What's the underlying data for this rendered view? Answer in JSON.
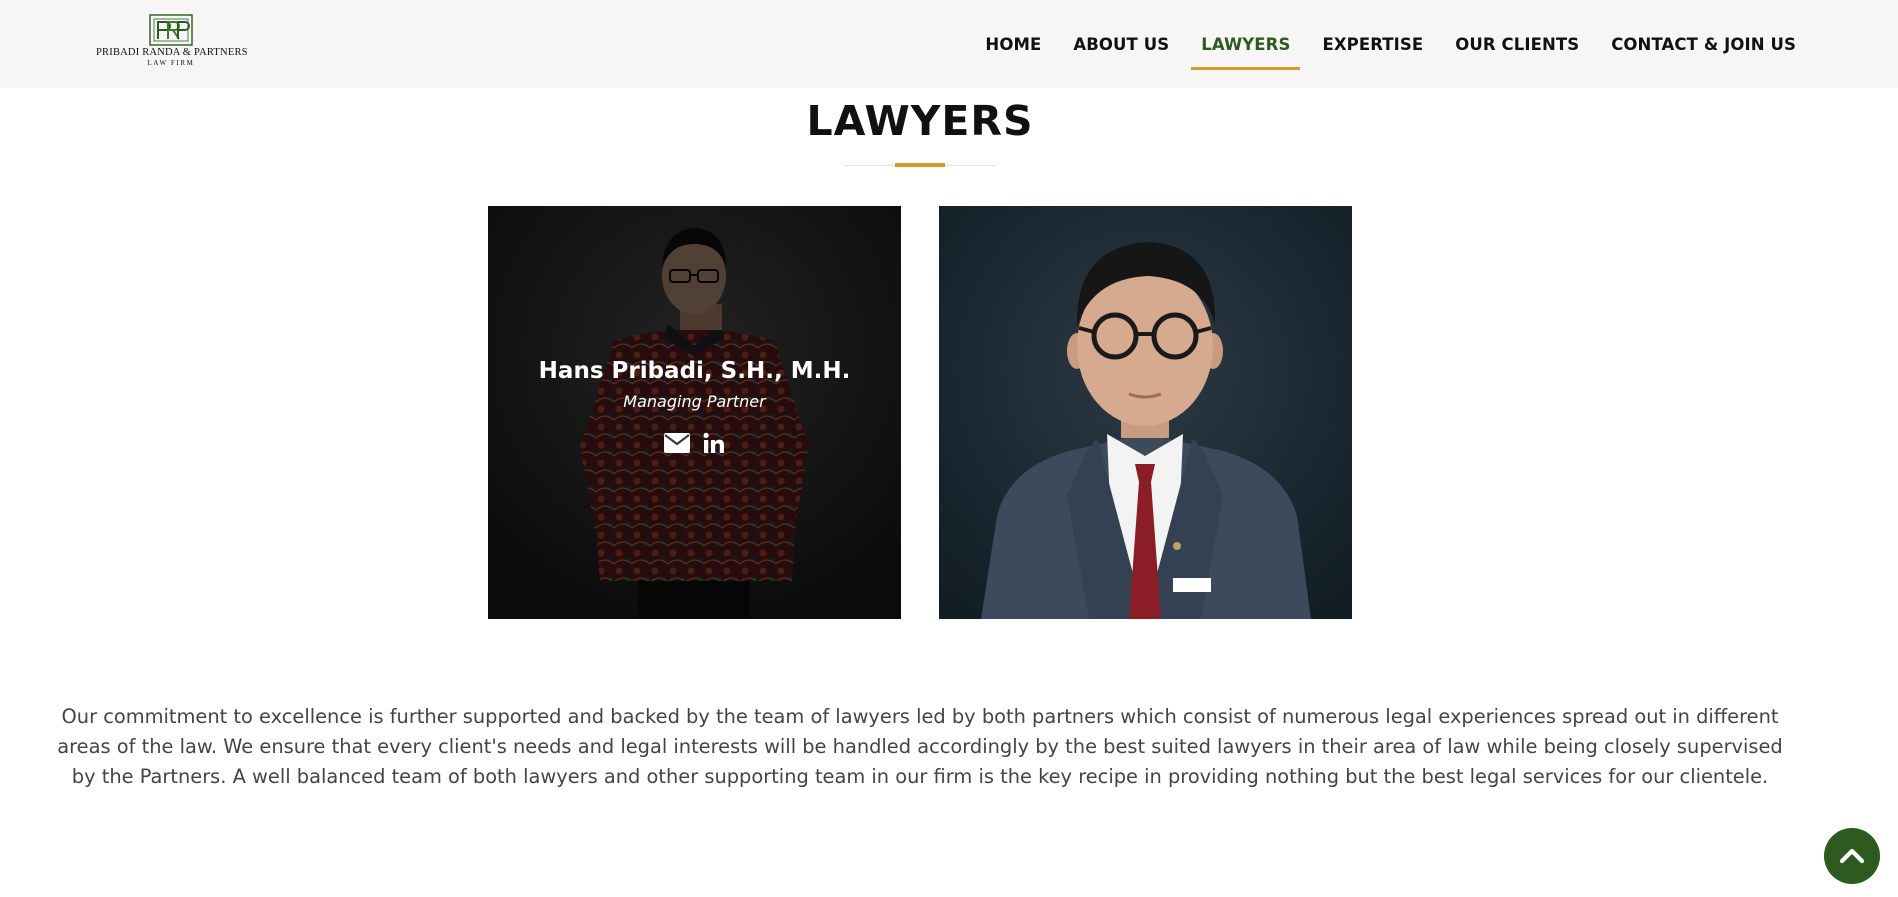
{
  "brand": {
    "name": "PRIBADI RANDA & PARTNERS",
    "subtitle": "LAW FIRM",
    "monogram": "PRP",
    "color": "#2d5a1e"
  },
  "nav": {
    "items": [
      {
        "label": "HOME",
        "active": false
      },
      {
        "label": "ABOUT US",
        "active": false
      },
      {
        "label": "LAWYERS",
        "active": true
      },
      {
        "label": "EXPERTISE",
        "active": false
      },
      {
        "label": "OUR CLIENTS",
        "active": false
      },
      {
        "label": "CONTACT & JOIN US",
        "active": false
      }
    ],
    "active_color": "#2d5a1e",
    "underline_color": "#d39b2b"
  },
  "page": {
    "title": "LAWYERS"
  },
  "lawyers": [
    {
      "name": "Hans Pribadi, S.H., M.H.",
      "role": "Managing Partner",
      "icons": [
        "envelope-icon",
        "linkedin-icon"
      ],
      "hovered": true
    },
    {
      "hovered": false
    }
  ],
  "intro": {
    "text": "Our commitment to excellence is further supported and backed by the team of lawyers led by both partners which consist of numerous legal experiences spread out in different areas of the law. We ensure that every client's needs and legal interests will be handled accordingly by the best suited lawyers in their area of law while being closely supervised by the Partners. A well balanced team of both lawyers and other supporting team in our firm is the key recipe in providing nothing but the best legal services for our clientele."
  },
  "back_to_top": {
    "icon": "chevron-up-icon",
    "color": "#2d5a1e"
  }
}
